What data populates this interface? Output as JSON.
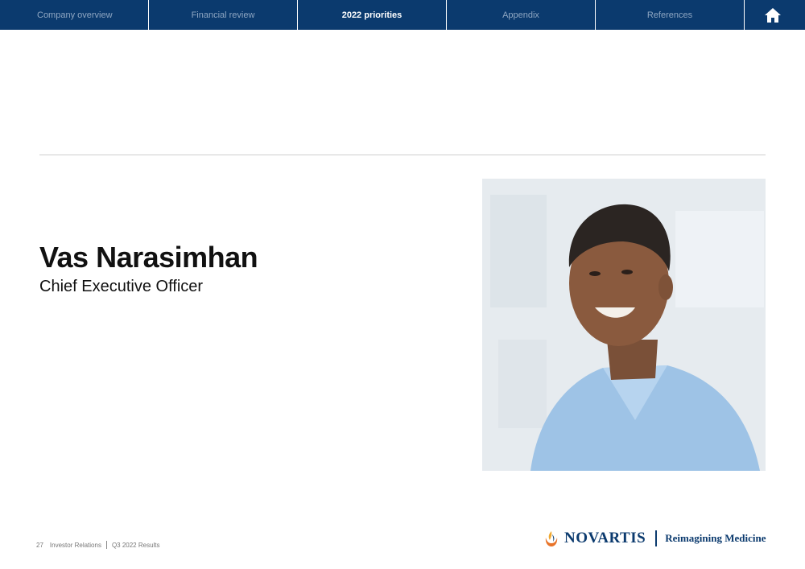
{
  "nav": {
    "tabs": [
      {
        "label": "Company overview"
      },
      {
        "label": "Financial review"
      },
      {
        "label": "2022 priorities"
      },
      {
        "label": "Appendix"
      },
      {
        "label": "References"
      }
    ],
    "home_icon": "home-icon"
  },
  "person": {
    "name": "Vas Narasimhan",
    "title": "Chief Executive Officer"
  },
  "footer": {
    "page_number": "27",
    "section": "Investor Relations",
    "document": "Q3 2022 Results"
  },
  "logo": {
    "brand": "NOVARTIS",
    "tagline": "Reimagining Medicine"
  },
  "colors": {
    "nav_background": "#0b3a6e",
    "brand_blue": "#0b3a6e",
    "logo_orange": "#e8742a",
    "logo_gold": "#f0a830"
  }
}
